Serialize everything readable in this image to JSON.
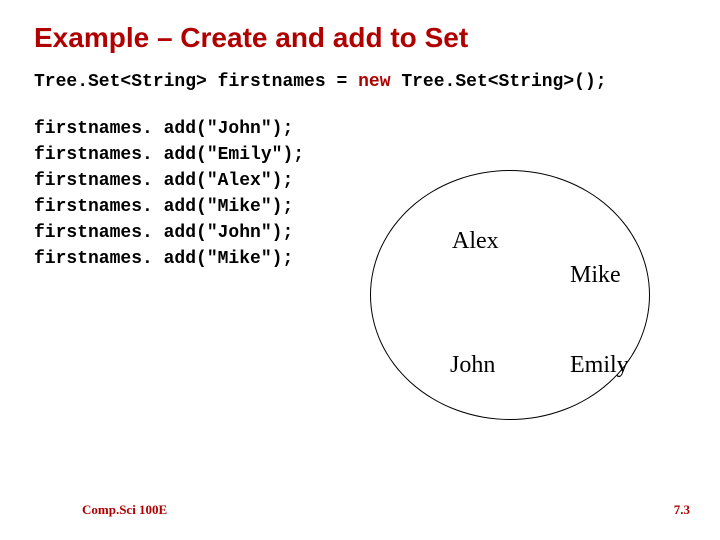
{
  "title": "Example – Create and add to Set",
  "declaration": {
    "type_left": "Tree.Set<String>",
    "var": "firstnames",
    "eq": "=",
    "kw_new": "new",
    "type_right": "Tree.Set<String>();"
  },
  "code_lines": [
    "firstnames. add(\"John\");",
    "firstnames. add(\"Emily\");",
    "firstnames. add(\"Alex\");",
    "firstnames. add(\"Mike\");",
    "firstnames. add(\"John\");",
    "firstnames. add(\"Mike\");"
  ],
  "set_members": {
    "alex": "Alex",
    "mike": "Mike",
    "john": "John",
    "emily": "Emily"
  },
  "footer": {
    "course": "Comp.Sci 100E",
    "page": "7.3"
  },
  "colors": {
    "accent": "#b00000"
  }
}
